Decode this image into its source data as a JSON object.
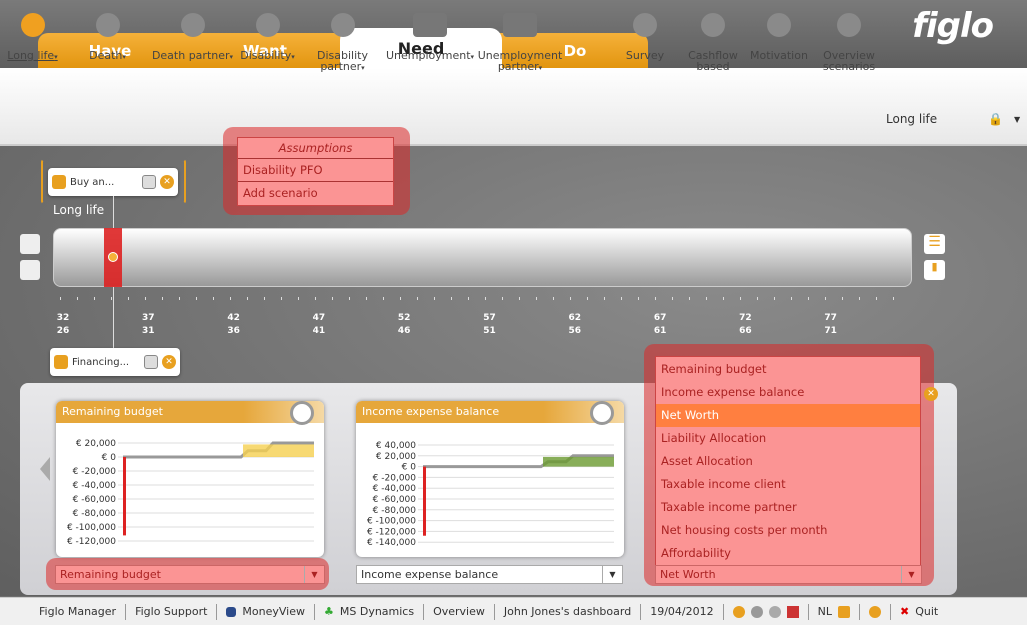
{
  "app": {
    "logo": "figlo"
  },
  "tabs": [
    {
      "label": "Have"
    },
    {
      "label": "Want"
    },
    {
      "label": "Need",
      "active": true
    },
    {
      "label": "Do"
    }
  ],
  "toolbar": {
    "items": [
      {
        "label": "Long life",
        "icon": "sun-icon",
        "dropdown": true,
        "selected": true
      },
      {
        "label": "Death",
        "icon": "person-dead-icon",
        "dropdown": true
      },
      {
        "label": "Death partner",
        "icon": "couple-dead-icon",
        "dropdown": true
      },
      {
        "label": "Disability",
        "icon": "person-disabled-icon",
        "dropdown": true
      },
      {
        "label": "Disability partner",
        "icon": "couple-disabled-icon",
        "dropdown": true
      },
      {
        "label": "Unemployment",
        "icon": "briefcase-x-icon",
        "dropdown": true
      },
      {
        "label": "Unemployment partner",
        "icon": "briefcases-x-icon",
        "dropdown": true
      },
      {
        "label": "Survey",
        "icon": "check-bubble-icon"
      },
      {
        "label": "Cashflow based",
        "icon": "scale-icon"
      },
      {
        "label": "Motivation",
        "icon": "person-speech-icon"
      },
      {
        "label": "Overview scenarios",
        "icon": "overview-icon"
      }
    ],
    "scenario_select": {
      "value": "Long life",
      "locked": true
    }
  },
  "disability_menu": {
    "items": [
      "Assumptions",
      "Disability PFO",
      "Add scenario"
    ]
  },
  "timeline": {
    "scenario_label": "Long life",
    "top_event": "Buy an...",
    "bottom_event": "Financing...",
    "ages_client": [
      "32",
      "37",
      "42",
      "47",
      "52",
      "57",
      "62",
      "67",
      "72",
      "77"
    ],
    "ages_partner": [
      "26",
      "31",
      "36",
      "41",
      "46",
      "51",
      "56",
      "61",
      "66",
      "71"
    ]
  },
  "charts": [
    {
      "title": "Remaining budget",
      "yticks": [
        "€ 20,000",
        "€ 0",
        "€ -20,000",
        "€ -40,000",
        "€ -60,000",
        "€ -80,000",
        "€ -100,000",
        "€ -120,000"
      ],
      "select": "Remaining budget"
    },
    {
      "title": "Income expense balance",
      "yticks": [
        "€ 40,000",
        "€ 20,000",
        "€ 0",
        "€ -20,000",
        "€ -40,000",
        "€ -60,000",
        "€ -80,000",
        "€ -100,000",
        "€ -120,000",
        "€ -140,000"
      ],
      "select": "Income expense balance"
    },
    {
      "select": "Net Worth"
    }
  ],
  "chart_menu": {
    "items": [
      "Remaining budget",
      "Income expense balance",
      "Net Worth",
      "Liability Allocation",
      "Asset Allocation",
      "Taxable income client",
      "Taxable income partner",
      "Net housing costs per month",
      "Affordability"
    ],
    "selected": "Net Worth"
  },
  "status": {
    "items": [
      "Figlo Manager",
      "Figlo Support",
      "MoneyView",
      "MS Dynamics",
      "Overview",
      "John Jones's dashboard",
      "19/04/2012",
      "NL",
      "Quit"
    ]
  },
  "colors": {
    "orange": "#e8a020",
    "highlight": "#fb9494",
    "selected": "#ff7f40"
  }
}
